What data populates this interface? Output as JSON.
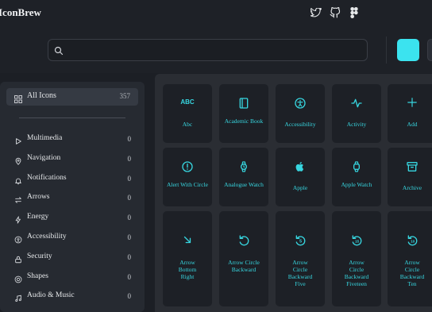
{
  "app": {
    "title": "IconBrew",
    "accent": "#3be3ef",
    "icon_color": "#37d6e0"
  },
  "header": {
    "social": [
      "twitter-icon",
      "github-icon",
      "figma-icon"
    ]
  },
  "search": {
    "placeholder": "",
    "value": ""
  },
  "sidebar": {
    "all": {
      "label": "All Icons",
      "count": "357"
    },
    "items": [
      {
        "label": "Multimedia",
        "count": "0",
        "icon": "play-icon"
      },
      {
        "label": "Navigation",
        "count": "0",
        "icon": "map-pin-icon"
      },
      {
        "label": "Notifications",
        "count": "0",
        "icon": "bell-icon"
      },
      {
        "label": "Arrows",
        "count": "0",
        "icon": "arrows-swap-icon"
      },
      {
        "label": "Energy",
        "count": "0",
        "icon": "bolt-icon"
      },
      {
        "label": "Accessibility",
        "count": "0",
        "icon": "accessibility-icon"
      },
      {
        "label": "Security",
        "count": "0",
        "icon": "lock-icon"
      },
      {
        "label": "Shapes",
        "count": "0",
        "icon": "shapes-icon"
      },
      {
        "label": "Audio & Music",
        "count": "0",
        "icon": "music-icon"
      }
    ]
  },
  "icons": [
    {
      "name": "Abc",
      "icon": "abc-icon"
    },
    {
      "name": "Academic Book",
      "icon": "book-icon"
    },
    {
      "name": "Accessibility",
      "icon": "accessibility-icon"
    },
    {
      "name": "Activity",
      "icon": "activity-icon"
    },
    {
      "name": "Add",
      "icon": "plus-icon"
    },
    {
      "name": "Alert With Circle",
      "icon": "alert-circle-icon"
    },
    {
      "name": "Analogue Watch",
      "icon": "watch-icon"
    },
    {
      "name": "Apple",
      "icon": "apple-icon"
    },
    {
      "name": "Apple Watch",
      "icon": "apple-watch-icon"
    },
    {
      "name": "Archive",
      "icon": "archive-icon"
    },
    {
      "name": "Arrow Bottom Right",
      "icon": "arrow-bottom-right-icon"
    },
    {
      "name": "Arrow Circle Backward",
      "icon": "arrow-circle-backward-icon"
    },
    {
      "name": "Arrow Circle Backward Five",
      "icon": "arrow-circle-backward-five-icon"
    },
    {
      "name": "Arrow Circle Backward Fiveteen",
      "icon": "arrow-circle-backward-fiveteen-icon"
    },
    {
      "name": "Arrow Circle Backward Ten",
      "icon": "arrow-circle-backward-ten-icon"
    }
  ]
}
